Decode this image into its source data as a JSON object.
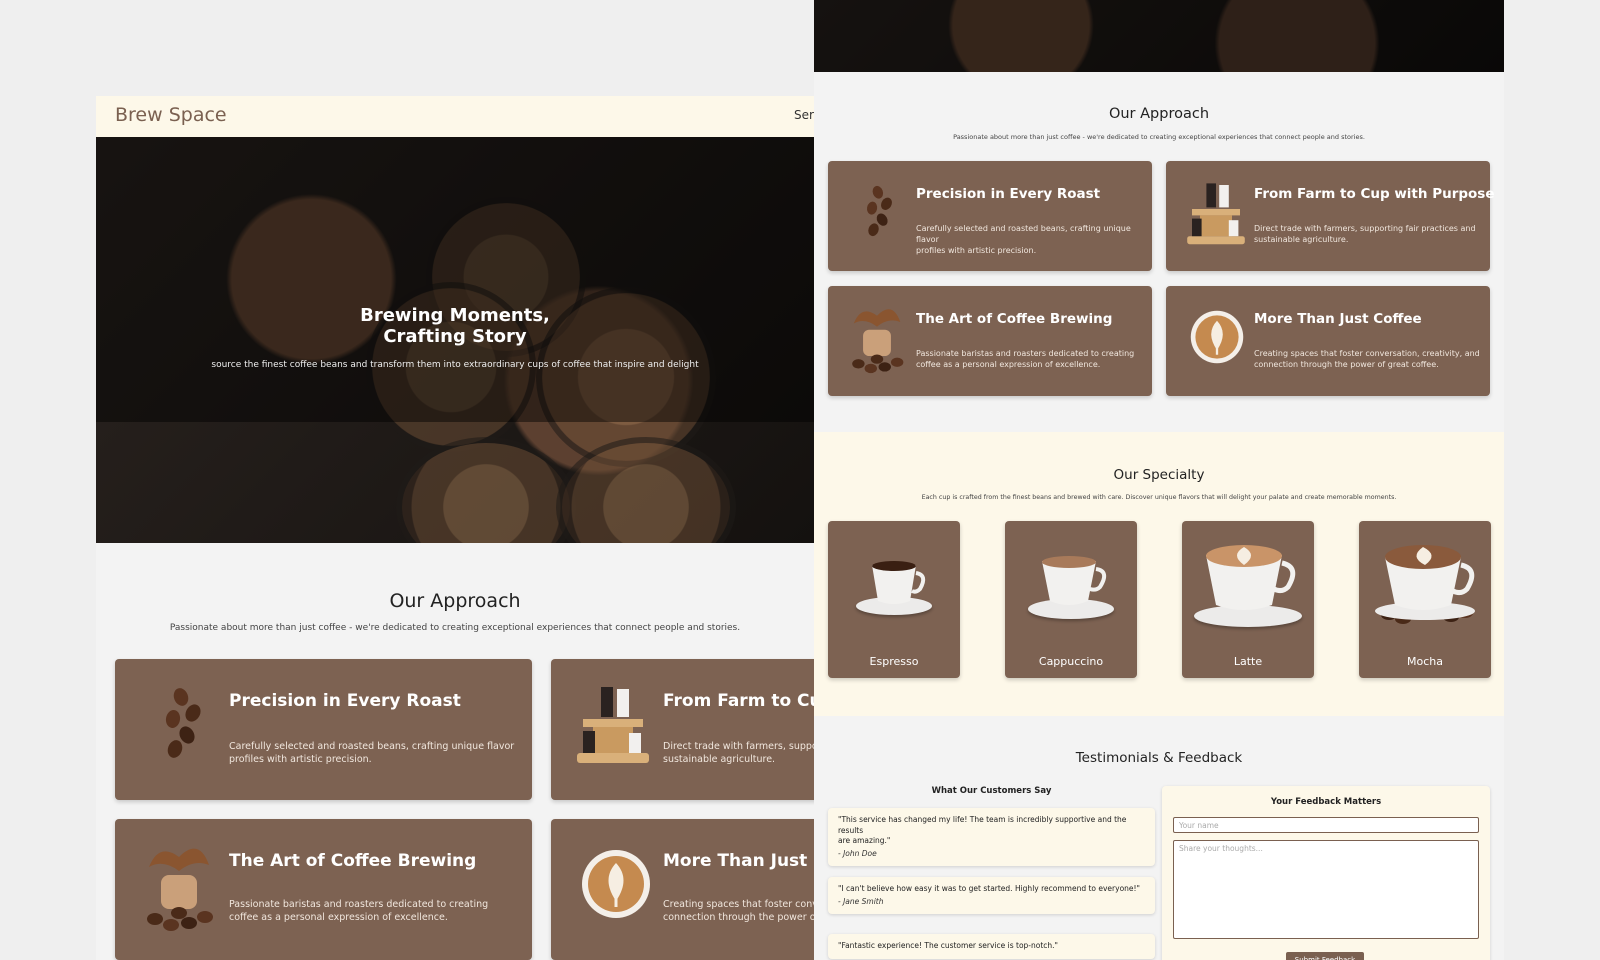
{
  "left": {
    "brand": "Brew Space",
    "nav_partial": "Serv",
    "hero": {
      "title_line1": "Brewing Moments,",
      "title_line2": "Crafting Story",
      "subtitle": "source the finest coffee beans and transform them into extraordinary cups of coffee that inspire and delight"
    },
    "approach": {
      "title": "Our Approach",
      "subtitle": "Passionate about more than just coffee - we're dedicated to creating exceptional experiences that connect people and stories.",
      "cards": [
        {
          "title": "Precision in Every Roast",
          "text_line1": "Carefully selected and roasted beans, crafting unique flavor",
          "text_line2": "profiles with artistic precision.",
          "icon": "coffee-beans-icon"
        },
        {
          "title": "From Farm to Cup",
          "text_line1": "Direct trade with farmers, suppo",
          "text_line2": "sustainable agriculture.",
          "icon": "coffee-stand-icon"
        },
        {
          "title": "The Art of Coffee Brewing",
          "text_line1": "Passionate baristas and roasters dedicated to creating",
          "text_line2": "coffee as a personal expression of excellence.",
          "icon": "coffee-splash-icon"
        },
        {
          "title": "More Than Just C",
          "text_line1": "Creating spaces that foster conv",
          "text_line2": "connection through the power o",
          "icon": "latte-art-icon"
        }
      ]
    }
  },
  "right": {
    "approach": {
      "title": "Our Approach",
      "subtitle": "Passionate about more than just coffee - we're dedicated to creating exceptional experiences that connect people and stories.",
      "cards": [
        {
          "title": "Precision in Every Roast",
          "text_line1": "Carefully selected and roasted beans, crafting unique flavor",
          "text_line2": "profiles with artistic precision.",
          "icon": "coffee-beans-icon"
        },
        {
          "title": "From Farm to Cup with Purpose",
          "text_line1": "Direct trade with farmers, supporting fair practices and",
          "text_line2": "sustainable agriculture.",
          "icon": "coffee-stand-icon"
        },
        {
          "title": "The Art of Coffee Brewing",
          "text_line1": "Passionate baristas and roasters dedicated to creating",
          "text_line2": "coffee as a personal expression of excellence.",
          "icon": "coffee-splash-icon"
        },
        {
          "title": "More Than Just Coffee",
          "text_line1": "Creating spaces that foster conversation, creativity, and",
          "text_line2": "connection through the power of great coffee.",
          "icon": "latte-art-icon"
        }
      ]
    },
    "specialty": {
      "title": "Our Specialty",
      "subtitle": "Each cup is crafted from the finest beans and brewed with care. Discover unique flavors that will delight your palate and create memorable moments.",
      "items": [
        {
          "name": "Espresso",
          "icon": "espresso-cup-icon"
        },
        {
          "name": "Cappuccino",
          "icon": "cappuccino-cup-icon"
        },
        {
          "name": "Latte",
          "icon": "latte-cup-icon"
        },
        {
          "name": "Mocha",
          "icon": "mocha-cup-icon"
        }
      ]
    },
    "testimonials": {
      "title": "Testimonials & Feedback",
      "list_title": "What Our Customers Say",
      "items": [
        {
          "quote_line1": "\"This service has changed my life! The team is incredibly supportive and the results",
          "quote_line2": "are amazing.\"",
          "author": "- John Doe"
        },
        {
          "quote_line1": "\"I can't believe how easy it was to get started. Highly recommend to everyone!\"",
          "quote_line2": "",
          "author": "- Jane Smith"
        },
        {
          "quote_line1": "\"Fantastic experience! The customer service is top-notch.\"",
          "quote_line2": "",
          "author": ""
        }
      ],
      "form": {
        "title": "Your Feedback Matters",
        "name_placeholder": "Your name",
        "message_placeholder": "Share your thoughts...",
        "submit_label": "Submit Feedback"
      }
    }
  },
  "colors": {
    "card_brown": "#7d6252",
    "cream": "#fdf8e9",
    "brand_text": "#7a6050",
    "page_bg": "#efefef"
  }
}
